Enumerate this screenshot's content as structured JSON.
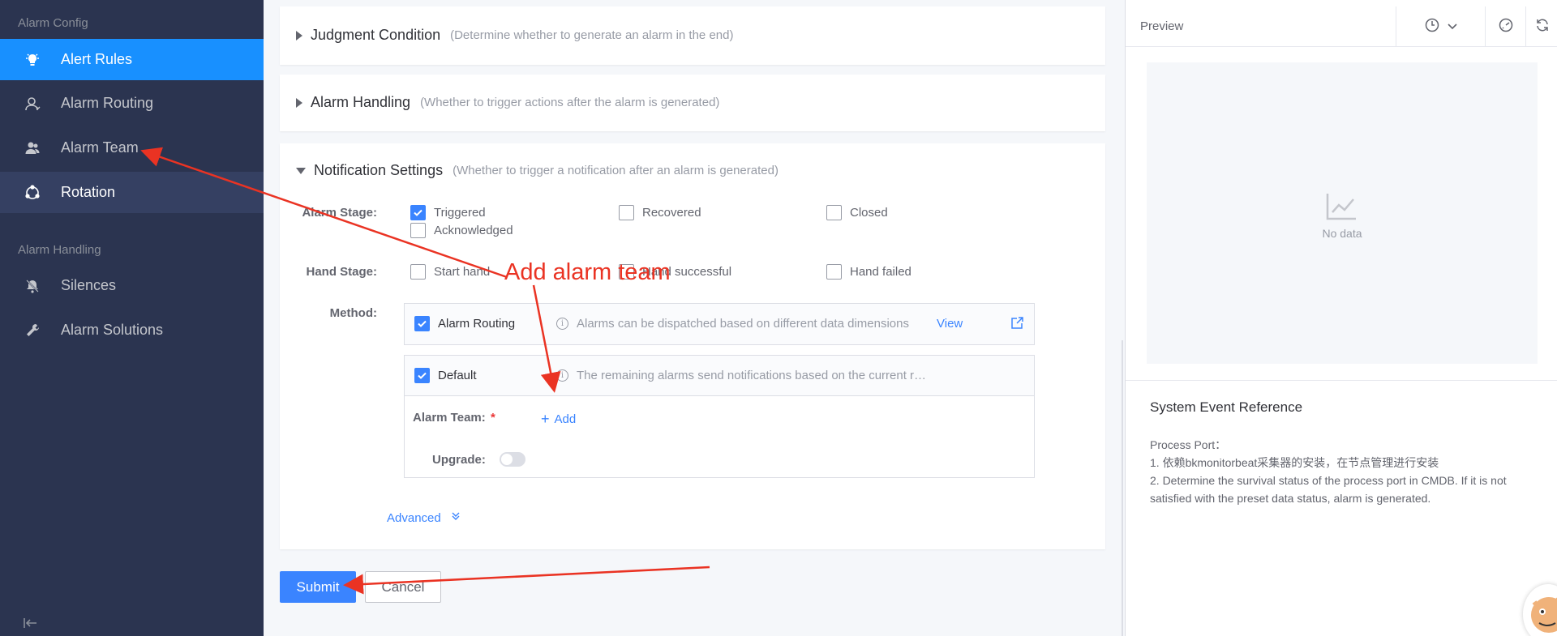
{
  "sidebar": {
    "group_alarm_config": "Alarm Config",
    "group_alarm_handling": "Alarm Handling",
    "items": [
      {
        "label": "Alert Rules",
        "icon": "bulb-icon"
      },
      {
        "label": "Alarm Routing",
        "icon": "user-route-icon"
      },
      {
        "label": "Alarm Team",
        "icon": "team-icon"
      },
      {
        "label": "Rotation",
        "icon": "rotation-icon"
      },
      {
        "label": "Silences",
        "icon": "bell-off-icon"
      },
      {
        "label": "Alarm Solutions",
        "icon": "wrench-icon"
      }
    ]
  },
  "sections": {
    "judgment": {
      "title": "Judgment Condition",
      "desc": "(Determine whether to generate an alarm in the end)"
    },
    "handling": {
      "title": "Alarm Handling",
      "desc": "(Whether to trigger actions after the alarm is generated)"
    },
    "notification": {
      "title": "Notification Settings",
      "desc": "(Whether to trigger a notification after an alarm is generated)"
    }
  },
  "form": {
    "alarm_stage_label": "Alarm Stage:",
    "alarm_stage_options": [
      {
        "label": "Triggered",
        "checked": true
      },
      {
        "label": "Recovered",
        "checked": false
      },
      {
        "label": "Closed",
        "checked": false
      },
      {
        "label": "Acknowledged",
        "checked": false
      }
    ],
    "hand_stage_label": "Hand Stage:",
    "hand_stage_options": [
      {
        "label": "Start hand",
        "checked": false
      },
      {
        "label": "Hand successful",
        "checked": false
      },
      {
        "label": "Hand failed",
        "checked": false
      }
    ],
    "method_label": "Method:",
    "method_routing": {
      "label": "Alarm Routing",
      "checked": true,
      "hint": "Alarms can be dispatched based on different data dimensions",
      "link": "View"
    },
    "method_default": {
      "label": "Default",
      "checked": true,
      "hint": "The remaining alarms send notifications based on the current r…"
    },
    "alarm_team_label": "Alarm Team:",
    "required_mark": "*",
    "add_label": "Add",
    "upgrade_label": "Upgrade:",
    "upgrade_on": false,
    "advanced_label": "Advanced"
  },
  "buttons": {
    "submit": "Submit",
    "cancel": "Cancel"
  },
  "preview": {
    "title": "Preview",
    "no_data": "No data",
    "ref_title": "System Event Reference",
    "ref_lines": [
      "Process Port：",
      "1. 依赖bkmonitorbeat采集器的安装，在节点管理进行安装",
      "2. Determine the survival status of the process port in CMDB. If it is not satisfied with the preset data status, alarm is generated."
    ]
  },
  "annotation": {
    "text": "Add alarm team",
    "color": "#ea3323"
  },
  "colors": {
    "sidebar_bg": "#2b3450",
    "active": "#1890ff",
    "primary": "#3a84ff"
  }
}
